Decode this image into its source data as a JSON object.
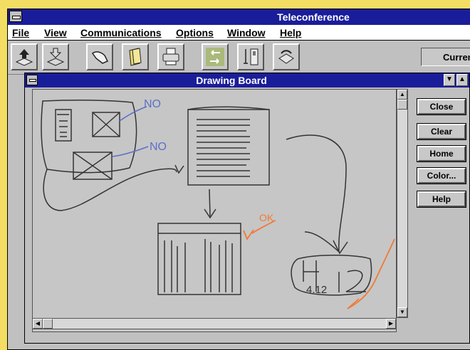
{
  "app": {
    "title": "Teleconference",
    "menu": [
      {
        "label": "File"
      },
      {
        "label": "View"
      },
      {
        "label": "Communications"
      },
      {
        "label": "Options"
      },
      {
        "label": "Window"
      },
      {
        "label": "Help"
      }
    ],
    "toolbar": {
      "status_label": "Curren"
    }
  },
  "drawing_board": {
    "title": "Drawing Board",
    "buttons": {
      "close": "Close",
      "clear": "Clear",
      "home": "Home",
      "color": "Color...",
      "help": "Help"
    },
    "annotations": {
      "no1": "NO",
      "no2": "NO",
      "ok": "OK.",
      "box_text": "4.12"
    }
  },
  "colors": {
    "titlebar": "#1a1d9a",
    "desktop": "#f3de63",
    "pen_blue": "#5f6fc9",
    "pen_orange": "#f07a35",
    "pen_dark": "#333333"
  }
}
